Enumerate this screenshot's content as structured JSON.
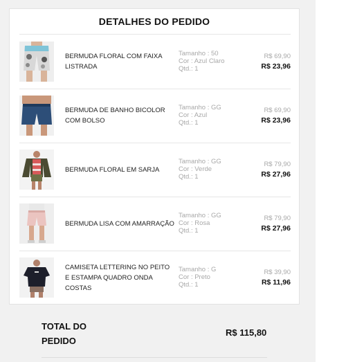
{
  "order": {
    "title": "DETALHES DO PEDIDO",
    "items": [
      {
        "name": "BERMUDA FLORAL COM FAIXA LISTRADA",
        "size": "Tamanho : 50",
        "color": "Cor : Azul Claro",
        "qty": "Qtd.: 1",
        "price_old": "R$ 69,90",
        "price_new": "R$ 23,96",
        "image_icon": "floral-shorts-photo"
      },
      {
        "name": "BERMUDA DE BANHO BICOLOR COM BOLSO",
        "size": "Tamanho : GG",
        "color": "Cor : Azul",
        "qty": "Qtd.: 1",
        "price_old": "R$ 69,90",
        "price_new": "R$ 23,96",
        "image_icon": "swim-shorts-photo"
      },
      {
        "name": "BERMUDA FLORAL EM SARJA",
        "size": "Tamanho : GG",
        "color": "Cor : Verde",
        "qty": "Qtd.: 1",
        "price_old": "R$ 79,90",
        "price_new": "R$ 27,96",
        "image_icon": "model-in-jacket-photo"
      },
      {
        "name": "BERMUDA LISA COM AMARRAÇÃO",
        "size": "Tamanho : GG",
        "color": "Cor : Rosa",
        "qty": "Qtd.: 1",
        "price_old": "R$ 79,90",
        "price_new": "R$ 27,96",
        "image_icon": "pink-shorts-photo"
      },
      {
        "name": "CAMISETA LETTERING NO PEITO E ESTAMPA QUADRO ONDA COSTAS",
        "size": "Tamanho : G",
        "color": "Cor : Preto",
        "qty": "Qtd.: 1",
        "price_old": "R$ 39,90",
        "price_new": "R$ 11,96",
        "image_icon": "black-tshirt-photo"
      }
    ],
    "total_label": "TOTAL DO PEDIDO",
    "total_value": "R$ 115,80"
  },
  "colors": {
    "background": "#f1f1f1",
    "card": "#ffffff",
    "muted_text": "#a8a8a8",
    "strong_text": "#111111"
  }
}
